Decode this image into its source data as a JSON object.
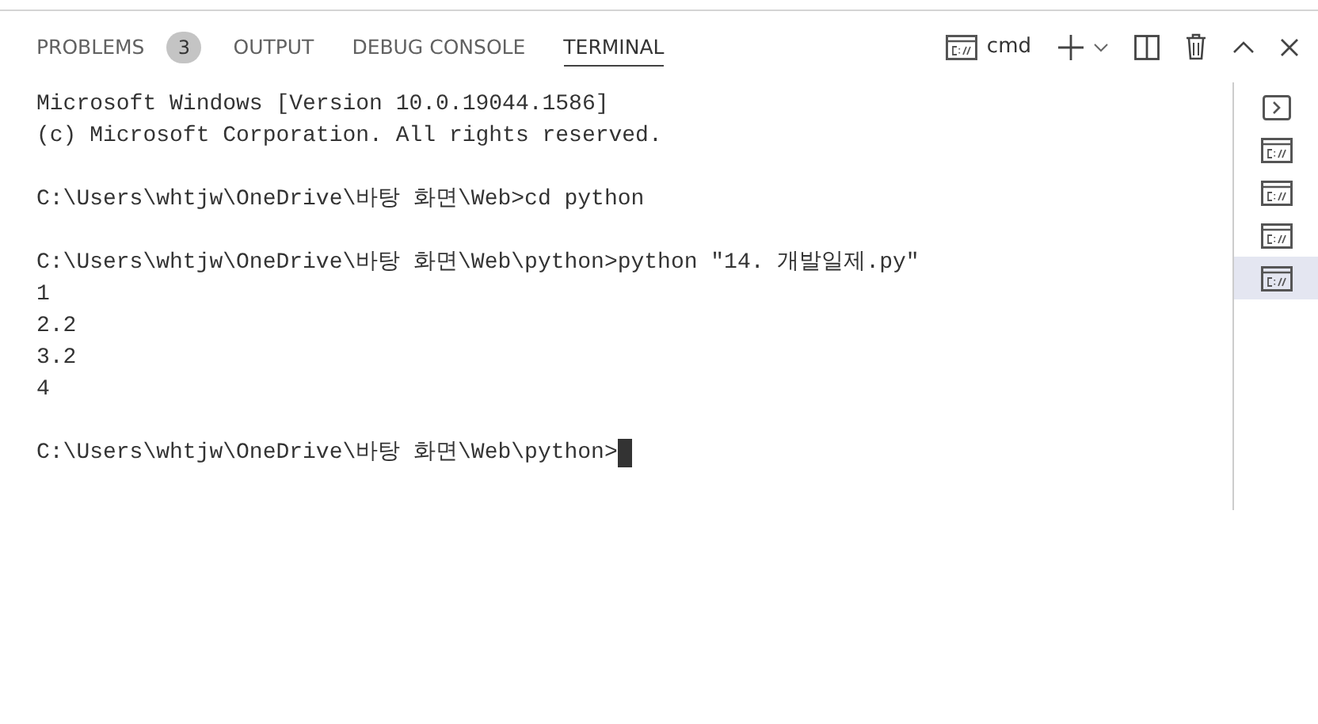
{
  "tabs": [
    {
      "label": "PROBLEMS",
      "badge": "3",
      "selected": false
    },
    {
      "label": "OUTPUT",
      "selected": false
    },
    {
      "label": "DEBUG CONSOLE",
      "selected": false
    },
    {
      "label": "TERMINAL",
      "selected": true
    }
  ],
  "toolbar": {
    "shell": "cmd"
  },
  "terminal": {
    "blocks": [
      [
        "Microsoft Windows [Version 10.0.19044.1586]",
        "(c) Microsoft Corporation. All rights reserved."
      ],
      [
        "C:\\Users\\whtjw\\OneDrive\\바탕 화면\\Web>cd python"
      ],
      [
        "C:\\Users\\whtjw\\OneDrive\\바탕 화면\\Web\\python>python \"14. 개발일제.py\"",
        "1",
        "2.2",
        "3.2",
        "4"
      ],
      [
        "C:\\Users\\whtjw\\OneDrive\\바탕 화면\\Web\\python>"
      ]
    ],
    "cursor": true
  },
  "instances": [
    {
      "kind": "shell",
      "selected": false
    },
    {
      "kind": "cmd",
      "selected": false
    },
    {
      "kind": "cmd",
      "selected": false
    },
    {
      "kind": "cmd",
      "selected": false
    },
    {
      "kind": "cmd",
      "selected": true
    }
  ]
}
